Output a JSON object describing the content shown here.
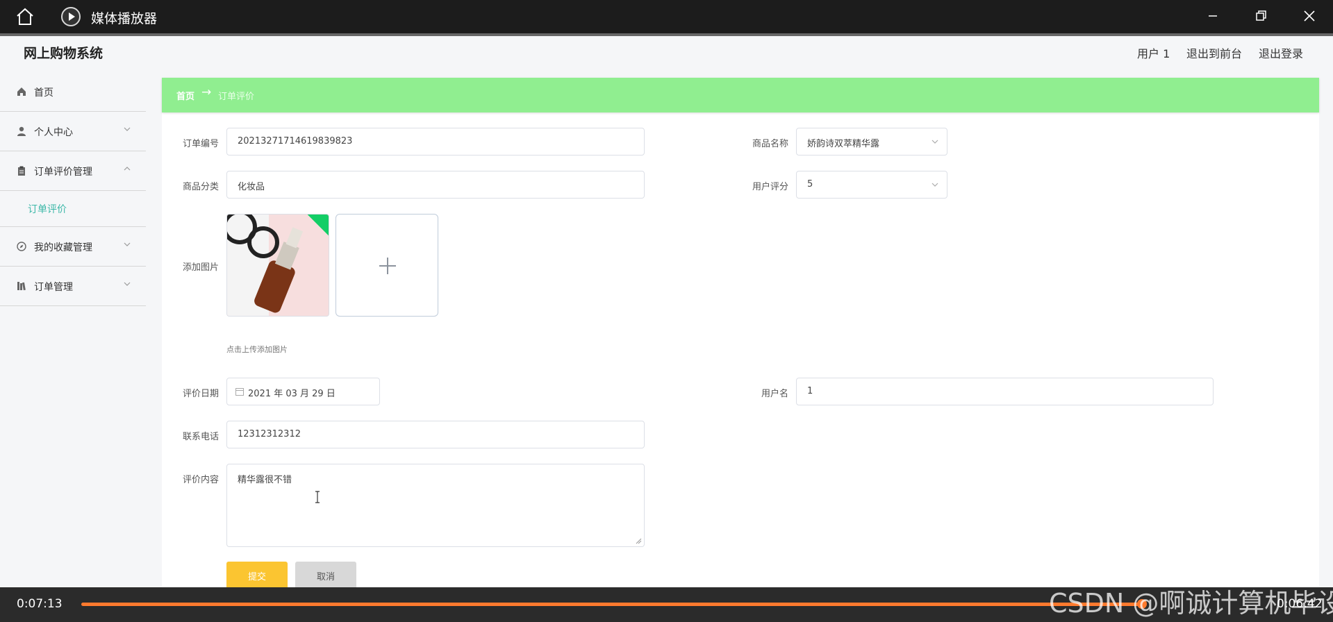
{
  "player": {
    "title": "媒体播放器",
    "time_current": "0:07:13",
    "time_total": "0:06:42",
    "progress": 0.975,
    "watermark": "CSDN @啊诚计算机毕设"
  },
  "header": {
    "site_title": "网上购物系统",
    "user": "用户 1",
    "to_front": "退出到前台",
    "logout": "退出登录"
  },
  "sidebar": {
    "items": [
      {
        "label": "首页",
        "icon": "home-icon"
      },
      {
        "label": "个人中心",
        "icon": "user-icon"
      },
      {
        "label": "订单评价管理",
        "icon": "clipboard-icon"
      },
      {
        "label": "订单评价",
        "icon": ""
      },
      {
        "label": "我的收藏管理",
        "icon": "compass-icon"
      },
      {
        "label": "订单管理",
        "icon": "books-icon"
      }
    ]
  },
  "breadcrumb": {
    "home": "首页",
    "arrow": "→",
    "current": "订单评价"
  },
  "form": {
    "order_no_label": "订单编号",
    "order_no": "20213271714619839823",
    "product_name_label": "商品名称",
    "product_name": "娇韵诗双萃精华露",
    "category_label": "商品分类",
    "category": "化妆品",
    "rating_label": "用户评分",
    "rating": "5",
    "image_label": "添加图片",
    "upload_tip": "点击上传添加图片",
    "date_label": "评价日期",
    "date": "2021 年 03 月 29 日",
    "username_label": "用户名",
    "username": "1",
    "phone_label": "联系电话",
    "phone": "12312312312",
    "content_label": "评价内容",
    "content": "精华露很不错",
    "submit": "提交",
    "cancel": "取消"
  },
  "colors": {
    "breadcrumb_bg": "#90ee90",
    "accent": "#3cb8a8",
    "submit_bg": "#fbc531",
    "progress": "#ff7a2e"
  }
}
